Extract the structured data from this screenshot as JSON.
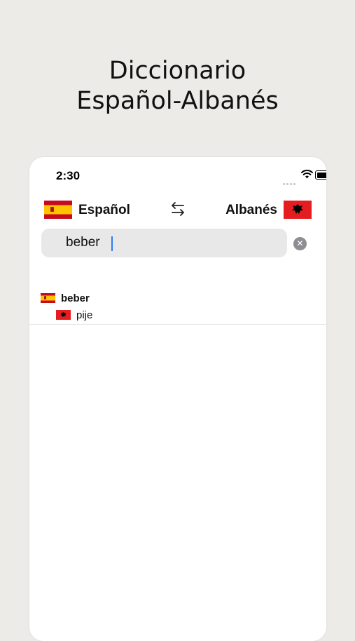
{
  "headline": {
    "line1": "Diccionario",
    "line2": "Español-Albanés"
  },
  "status_bar": {
    "time": "2:30"
  },
  "languages": {
    "source": "Español",
    "target": "Albanés"
  },
  "search": {
    "value": "beber"
  },
  "icons": {
    "swap": "swap-arrows-icon",
    "clear": "clear-circle-icon",
    "source_flag": "spain-flag-icon",
    "target_flag": "albania-flag-icon"
  },
  "results": [
    {
      "word": "beber",
      "translation": "pije"
    }
  ],
  "colors": {
    "background": "#edebe8",
    "caret": "#2f7cf6",
    "search_bg": "#e8e8e9"
  }
}
